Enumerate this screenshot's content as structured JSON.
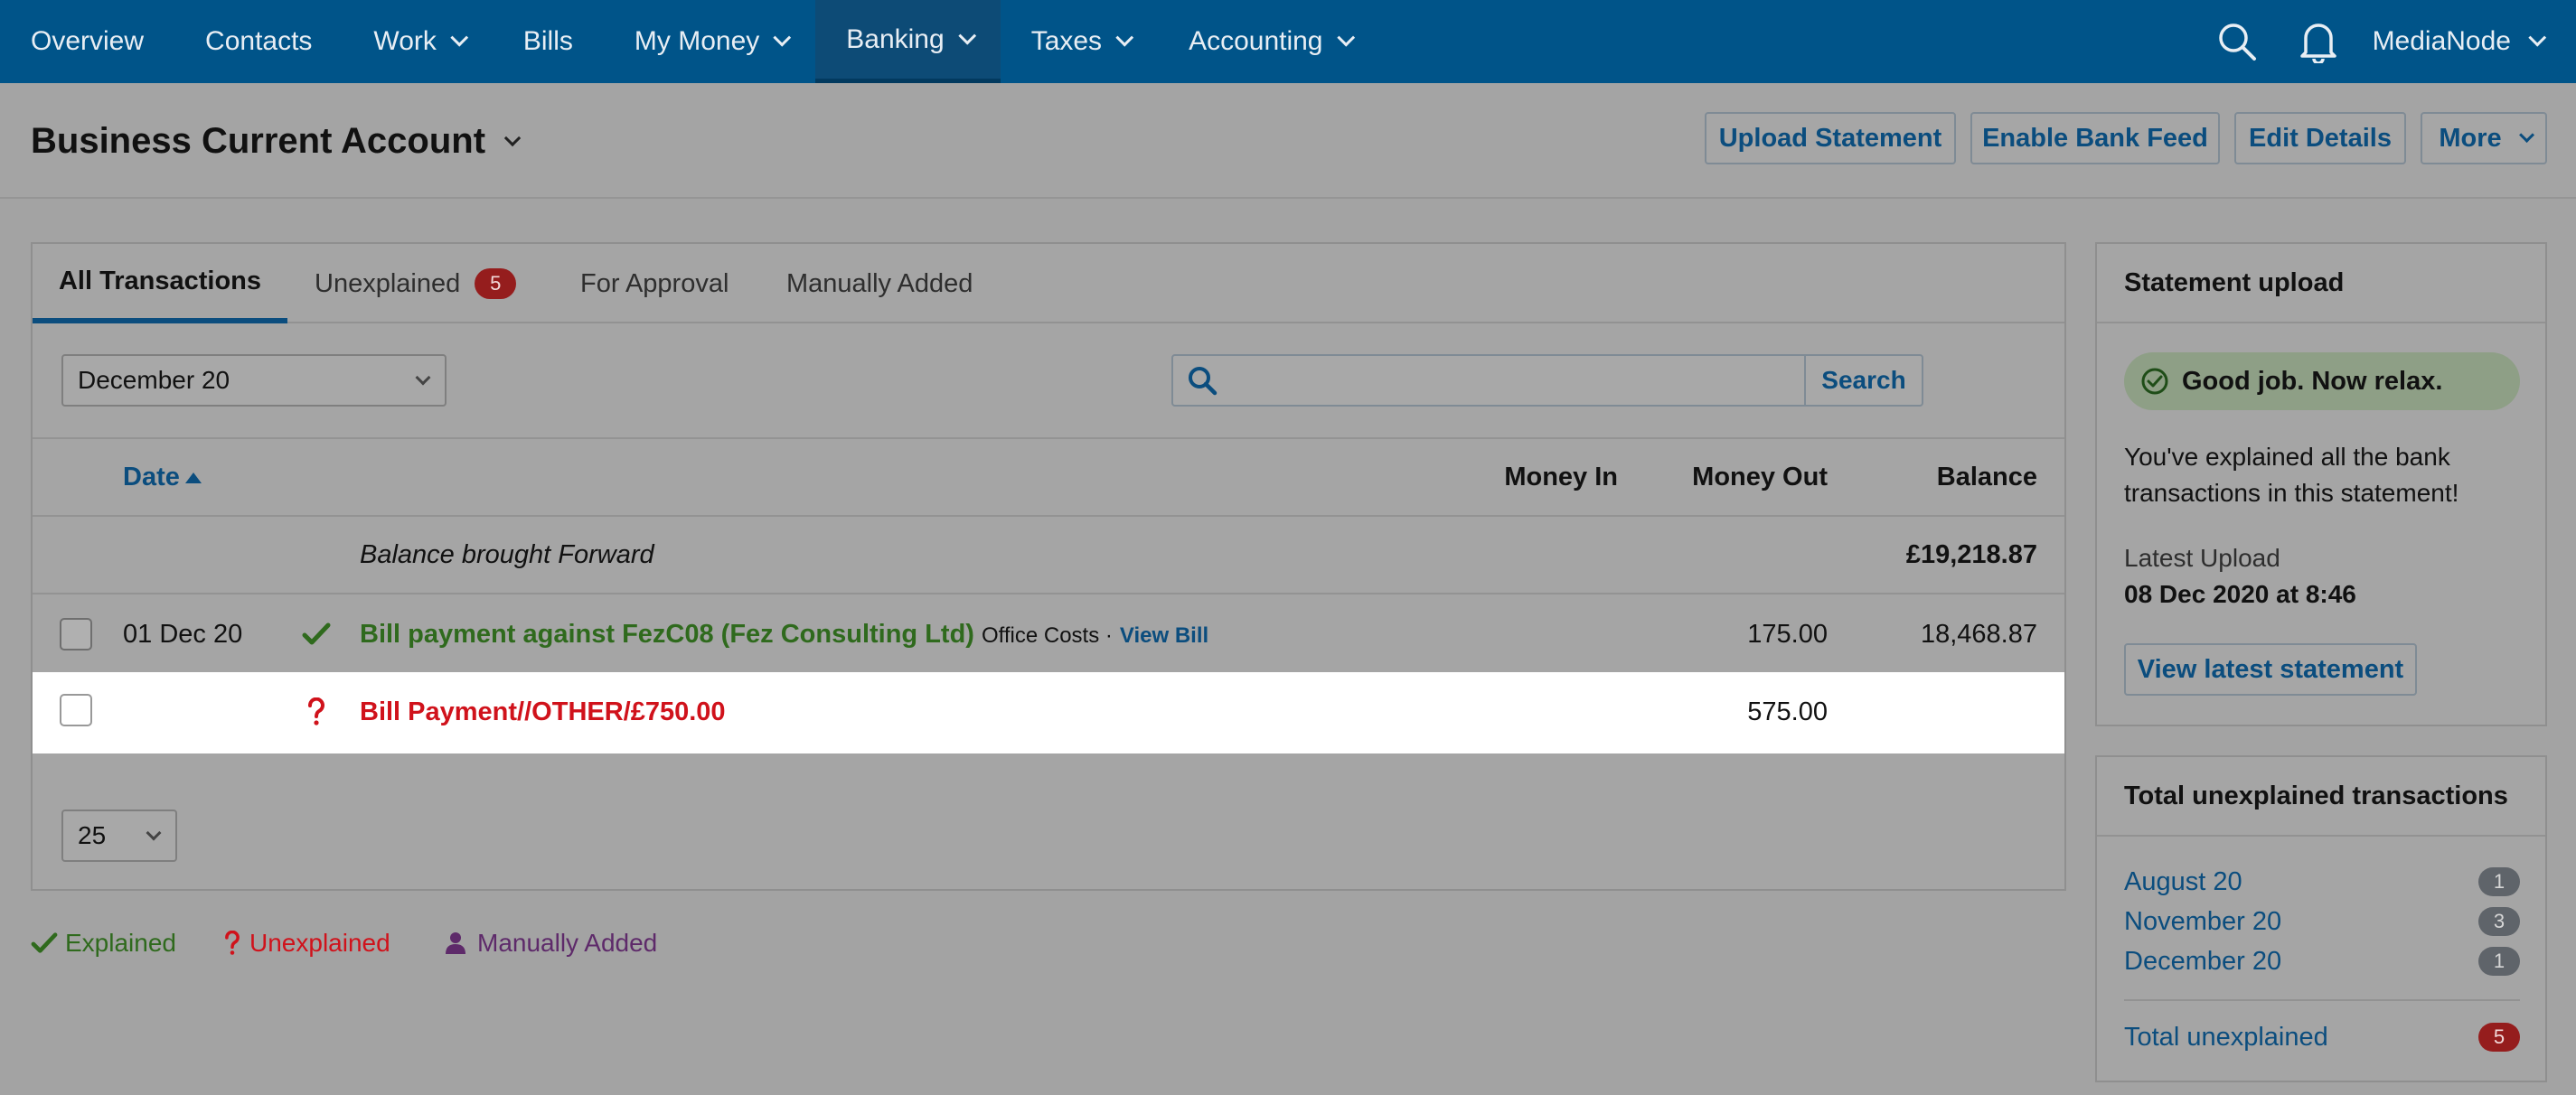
{
  "nav": {
    "items": [
      {
        "label": "Overview",
        "has_menu": false
      },
      {
        "label": "Contacts",
        "has_menu": false
      },
      {
        "label": "Work",
        "has_menu": true
      },
      {
        "label": "Bills",
        "has_menu": false
      },
      {
        "label": "My Money",
        "has_menu": true
      },
      {
        "label": "Banking",
        "has_menu": true,
        "active": true
      },
      {
        "label": "Taxes",
        "has_menu": true
      },
      {
        "label": "Accounting",
        "has_menu": true
      }
    ],
    "user": "MediaNode",
    "icons": [
      "search-icon",
      "bell-icon"
    ]
  },
  "header": {
    "title": "Business Current Account",
    "buttons": {
      "upload": "Upload Statement",
      "bank_feed": "Enable Bank Feed",
      "edit": "Edit Details",
      "more": "More"
    }
  },
  "tabs": {
    "all": "All Transactions",
    "unexplained": "Unexplained",
    "unexplained_count": "5",
    "approval": "For Approval",
    "manual": "Manually Added"
  },
  "filters": {
    "month": "December 20",
    "search_placeholder": "",
    "search_button": "Search"
  },
  "table": {
    "headers": {
      "date": "Date",
      "money_in": "Money In",
      "money_out": "Money Out",
      "balance": "Balance"
    },
    "brought_forward": {
      "label": "Balance brought Forward",
      "balance": "£19,218.87"
    },
    "rows": [
      {
        "date": "01 Dec 20",
        "status": "explained",
        "description": "Bill payment against FezC08 (Fez Consulting Ltd)",
        "category": "Office Costs ·",
        "link": "View Bill",
        "money_out": "175.00",
        "balance": "18,468.87"
      },
      {
        "date": "",
        "status": "unexplained",
        "description": "Bill Payment//OTHER/£750.00",
        "money_out": "575.00",
        "balance": ""
      }
    ],
    "page_size": "25"
  },
  "legend": {
    "explained": "Explained",
    "unexplained": "Unexplained",
    "manual": "Manually Added"
  },
  "statement": {
    "title": "Statement upload",
    "status": "Good job. Now relax.",
    "message": "You've explained all the bank transactions in this statement!",
    "latest_label": "Latest Upload",
    "latest_value": "08 Dec 2020 at 8:46",
    "button": "View latest statement"
  },
  "unexplained": {
    "title": "Total unexplained transactions",
    "months": [
      {
        "label": "August 20",
        "count": "1"
      },
      {
        "label": "November 20",
        "count": "3"
      },
      {
        "label": "December 20",
        "count": "1"
      }
    ],
    "total_label": "Total unexplained",
    "total_count": "5"
  },
  "colors": {
    "nav_bg": "#005489",
    "accent": "#0b4d7e",
    "explained": "#2f6a1d",
    "unexplained": "#d0121b",
    "manual": "#5e2a6a"
  }
}
